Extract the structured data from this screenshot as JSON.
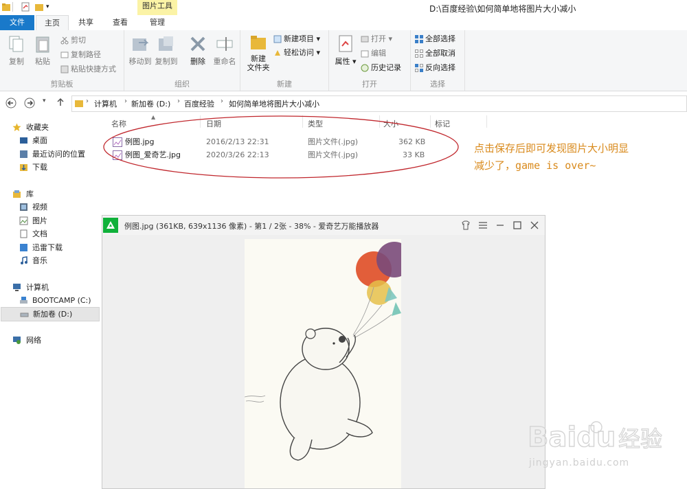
{
  "window": {
    "path_title": "D:\\百度经验\\如何简单地将图片大小减小",
    "context_tab_group": "图片工具"
  },
  "ribbon_tabs": [
    "文件",
    "主页",
    "共享",
    "查看",
    "管理"
  ],
  "ribbon": {
    "clipboard": {
      "label": "剪贴板",
      "copy": "复制",
      "paste": "粘贴",
      "cut": "剪切",
      "copy_path": "复制路径",
      "paste_shortcut": "粘贴快捷方式"
    },
    "organize": {
      "label": "组织",
      "move_to": "移动到",
      "copy_to": "复制到",
      "delete": "删除",
      "rename": "重命名"
    },
    "new": {
      "label": "新建",
      "new_folder_l1": "新建",
      "new_folder_l2": "文件夹",
      "new_item": "新建项目",
      "easy_access": "轻松访问"
    },
    "open": {
      "label": "打开",
      "properties": "属性",
      "open": "打开",
      "edit": "编辑",
      "history": "历史记录"
    },
    "select": {
      "label": "选择",
      "select_all": "全部选择",
      "select_none": "全部取消",
      "invert": "反向选择"
    }
  },
  "breadcrumbs": [
    "计算机",
    "新加卷 (D:)",
    "百度经验",
    "如何简单地将图片大小减小"
  ],
  "nav": {
    "favorites": "收藏夹",
    "desktop": "桌面",
    "recent": "最近访问的位置",
    "downloads": "下载",
    "libraries": "库",
    "videos": "视频",
    "pictures": "图片",
    "documents": "文档",
    "thunder": "迅雷下载",
    "music": "音乐",
    "computer": "计算机",
    "bootcamp": "BOOTCAMP (C:)",
    "drive_d": "新加卷 (D:)",
    "network": "网络"
  },
  "columns": {
    "name": "名称",
    "date": "日期",
    "type": "类型",
    "size": "大小",
    "tags": "标记"
  },
  "files": [
    {
      "name": "例图.jpg",
      "date": "2016/2/13 22:31",
      "type": "图片文件(.jpg)",
      "size": "362 KB"
    },
    {
      "name": "例图_爱奇艺.jpg",
      "date": "2020/3/26 22:13",
      "type": "图片文件(.jpg)",
      "size": "33 KB"
    }
  ],
  "annotation": {
    "line1": "点击保存后即可发现图片大小明显",
    "line2": "减少了，game is over~"
  },
  "viewer": {
    "title": "例图.jpg (361KB, 639x1136 像素) - 第1 / 2张 - 38% - 爱奇艺万能播放器"
  },
  "watermark": {
    "brand": "Baidu",
    "brand_suffix": "经验",
    "url": "jingyan.baidu.com"
  },
  "colors": {
    "file_tab": "#1979ca",
    "annotation": "#d98a1c",
    "ellipse": "#c0262c",
    "viewer_logo": "#10b13a",
    "tool_context": "#fbf3a6"
  }
}
